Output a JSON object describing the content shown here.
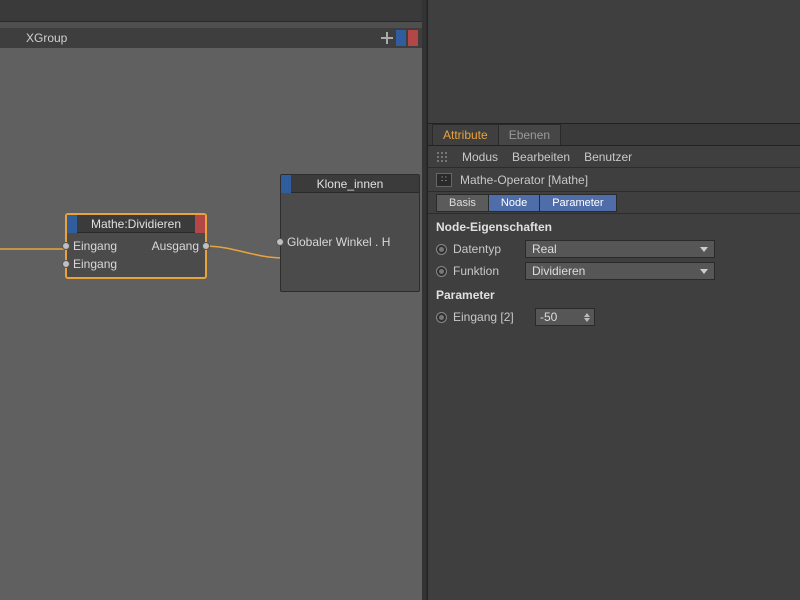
{
  "group": {
    "title": "XGroup"
  },
  "nodes": {
    "math": {
      "title": "Mathe:Dividieren",
      "inputs": [
        "Eingang",
        "Eingang"
      ],
      "outputs": [
        "Ausgang"
      ]
    },
    "target": {
      "title": "Klone_innen",
      "inputs": [
        "Globaler Winkel . H"
      ]
    }
  },
  "attr": {
    "tabs": {
      "attribute": "Attribute",
      "ebenen": "Ebenen"
    },
    "menu": {
      "modus": "Modus",
      "bearbeiten": "Bearbeiten",
      "benutzer": "Benutzer"
    },
    "object_title": "Mathe-Operator [Mathe]",
    "subtabs": {
      "basis": "Basis",
      "node": "Node",
      "parameter": "Parameter"
    },
    "section_node": "Node-Eigenschaften",
    "datentyp": {
      "label": "Datentyp",
      "value": "Real"
    },
    "funktion": {
      "label": "Funktion",
      "value": "Dividieren"
    },
    "section_param": "Parameter",
    "eingang2": {
      "label": "Eingang [2]",
      "value": "-50"
    }
  }
}
